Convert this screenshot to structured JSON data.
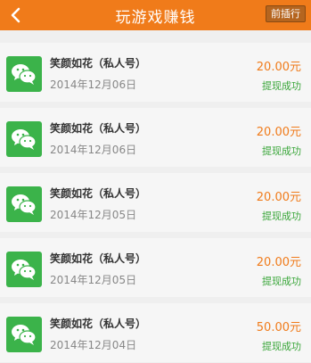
{
  "header": {
    "title": "玩游戏赚钱",
    "rank_label": "前插行",
    "back_icon": "chevron-left-icon"
  },
  "colors": {
    "accent": "#f07b1a",
    "success": "#3aa63a",
    "avatar_bg": "#3bb34a"
  },
  "records": [
    {
      "name": "笑颜如花（私人号）",
      "date": "2014年12月06日",
      "amount": "20.00元",
      "status": "提现成功",
      "icon": "wechat-icon"
    },
    {
      "name": "笑颜如花（私人号）",
      "date": "2014年12月06日",
      "amount": "20.00元",
      "status": "提现成功",
      "icon": "wechat-icon"
    },
    {
      "name": "笑颜如花（私人号）",
      "date": "2014年12月05日",
      "amount": "20.00元",
      "status": "提现成功",
      "icon": "wechat-icon"
    },
    {
      "name": "笑颜如花（私人号）",
      "date": "2014年12月05日",
      "amount": "20.00元",
      "status": "提现成功",
      "icon": "wechat-icon"
    },
    {
      "name": "笑颜如花（私人号）",
      "date": "2014年12月04日",
      "amount": "50.00元",
      "status": "提现成功",
      "icon": "wechat-icon"
    }
  ]
}
